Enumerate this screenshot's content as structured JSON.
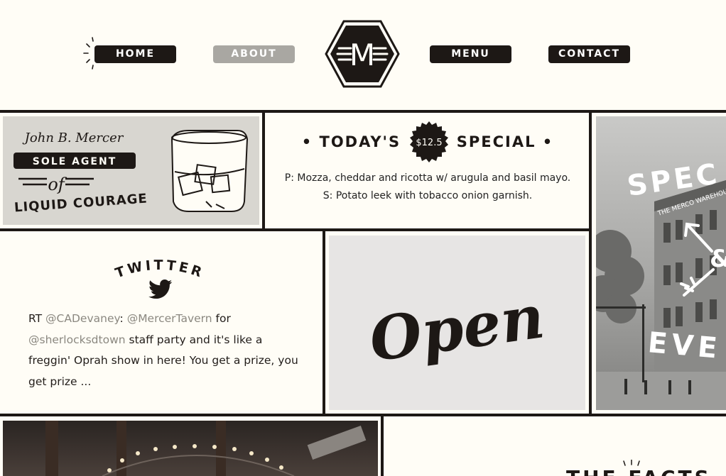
{
  "nav": {
    "home": "HOME",
    "about": "ABOUT",
    "menu": "MENU",
    "contact": "CONTACT",
    "logo_letter": "M"
  },
  "promo": {
    "signature": "John B. Mercer",
    "banner": "SOLE AGENT",
    "of": "of",
    "tagline": "LIQUID COURAGE"
  },
  "special": {
    "left": "TODAY'S",
    "price": "$12.5",
    "right": "SPECIAL",
    "description": "P: Mozza, cheddar and ricotta w/ arugula and basil mayo. S: Potato leek with tobacco onion garnish."
  },
  "twitter": {
    "heading": "TWITTER",
    "tweet": {
      "prefix": "RT ",
      "handle1": "@CADevaney",
      "sep": ": ",
      "handle2": "@MercerTavern",
      "mid": " for",
      "handle3": "@sherlocksdtown",
      "rest": " staff party and it's like a freggin' Oprah show in here! You get a prize, you get prize ..."
    }
  },
  "open_sign": {
    "text": "Open"
  },
  "photo_side": {
    "top_word": "SPEC",
    "amp": "&",
    "bottom_word": "EVE",
    "building_sign": "THE MERCO WAREHOUSE"
  },
  "bottom": {
    "heading_partial": "THE FACTS"
  },
  "colors": {
    "ink": "#1d1815",
    "paper": "#fffdf6",
    "grey_button": "#a9a7a2",
    "handle": "#8b8880"
  }
}
